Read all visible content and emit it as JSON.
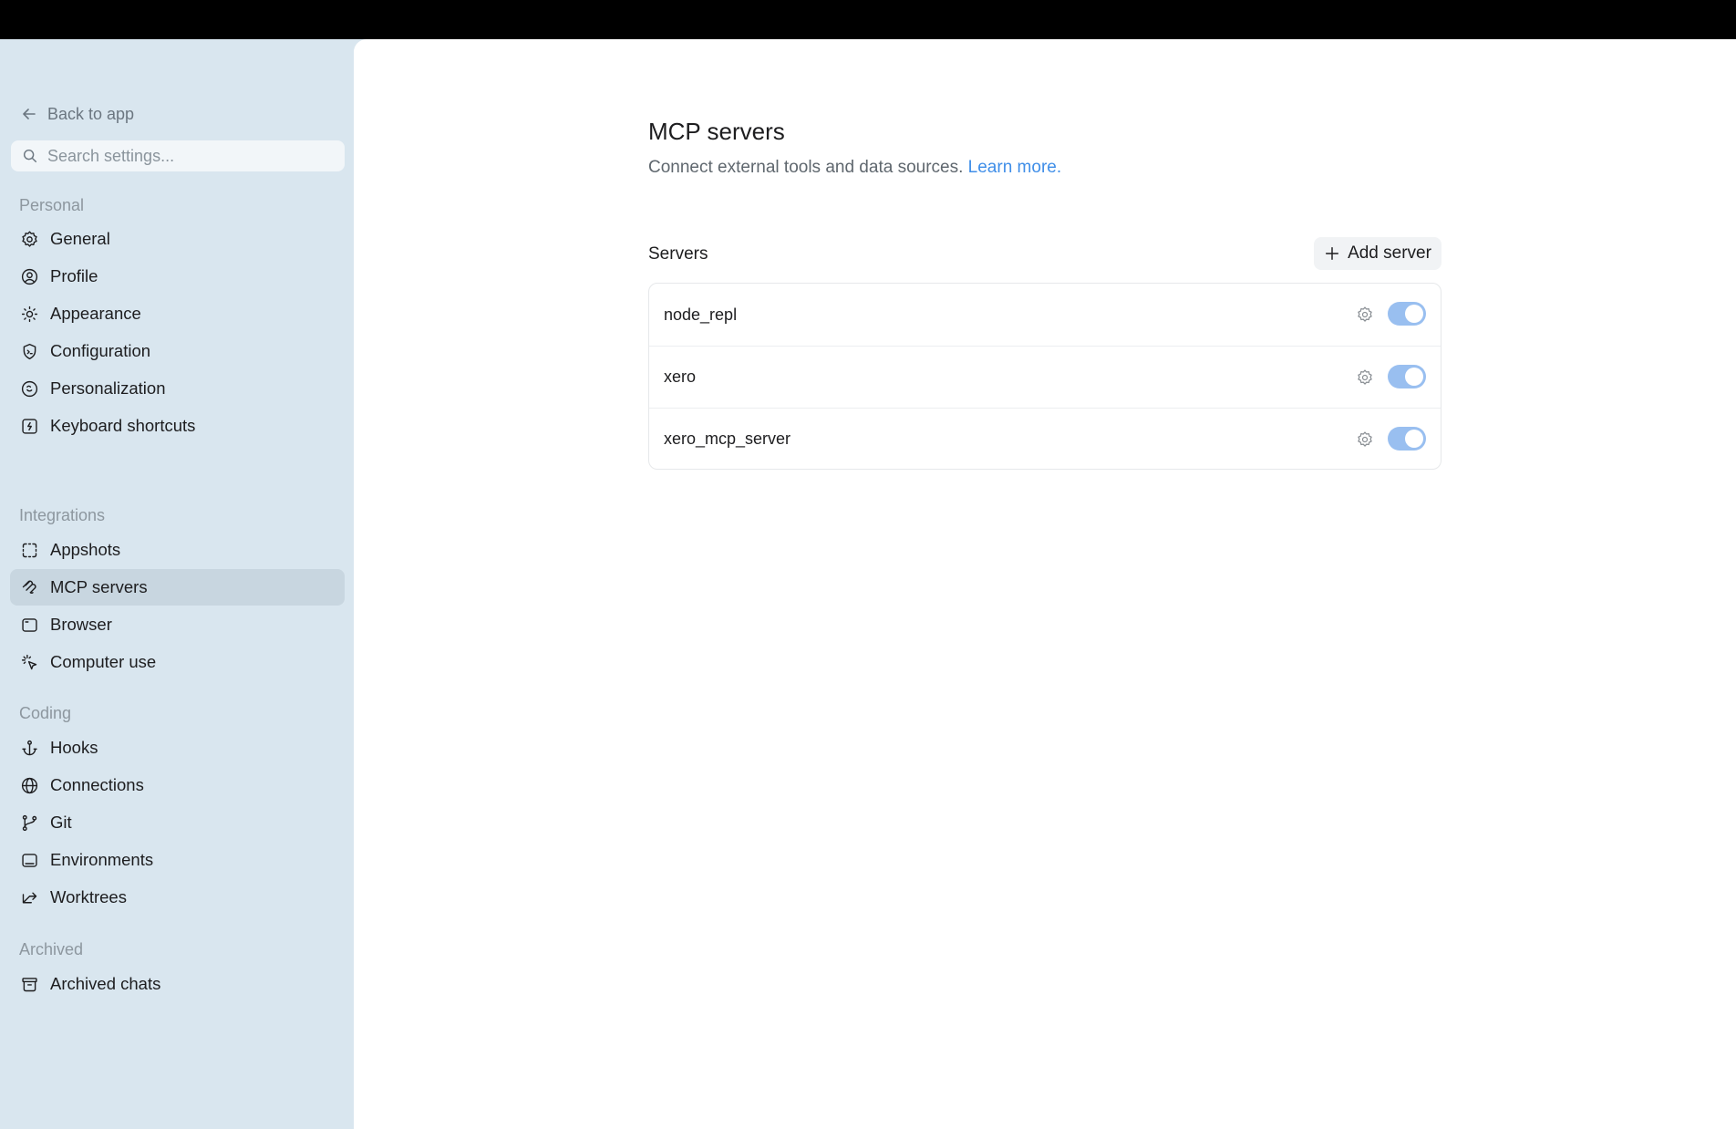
{
  "sidebar": {
    "back_label": "Back to app",
    "search_placeholder": "Search settings...",
    "sections": {
      "personal": "Personal",
      "integrations": "Integrations",
      "coding": "Coding",
      "archived": "Archived"
    },
    "items": {
      "general": "General",
      "profile": "Profile",
      "appearance": "Appearance",
      "configuration": "Configuration",
      "personalization": "Personalization",
      "keyboard_shortcuts": "Keyboard shortcuts",
      "appshots": "Appshots",
      "mcp_servers": "MCP servers",
      "browser": "Browser",
      "computer_use": "Computer use",
      "hooks": "Hooks",
      "connections": "Connections",
      "git": "Git",
      "environments": "Environments",
      "worktrees": "Worktrees",
      "archived_chats": "Archived chats"
    },
    "active_item": "MCP servers"
  },
  "main": {
    "title": "MCP servers",
    "subtitle": "Connect external tools and data sources.",
    "learn_more": "Learn more.",
    "servers_label": "Servers",
    "add_server_label": "Add server",
    "servers": [
      {
        "name": "node_repl",
        "enabled": true
      },
      {
        "name": "xero",
        "enabled": true
      },
      {
        "name": "xero_mcp_server",
        "enabled": true
      }
    ]
  },
  "colors": {
    "sidebar_bg": "#d9e6ef",
    "active_item_bg": "#c8d6e0",
    "link": "#3f8ee8",
    "toggle_on": "#99bff0"
  }
}
